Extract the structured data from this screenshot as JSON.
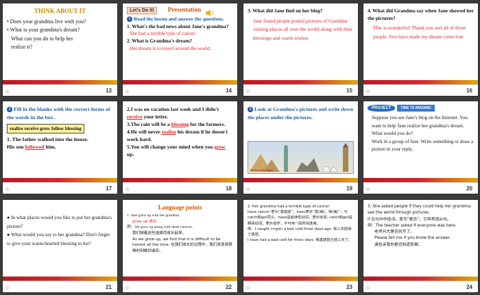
{
  "slides": [
    {
      "num": "13",
      "title": "THINK ABOUT IT",
      "lines": [
        "• Does your grandma live with you?",
        "• What is your grandma's dream?",
        "What can you do to help her",
        "realize it?"
      ]
    },
    {
      "num": "14",
      "title": "Presentation",
      "badge": "Let's Do It!",
      "heading": "Read the lesson and answer the questions.",
      "q1": "1. What's the bad news about Jane's grandma?",
      "a1": "She had a terrible type of cancer.",
      "q2": "2. What is Grandma's dream?",
      "a2": "Her dream is to travel around the world."
    },
    {
      "num": "15",
      "q": "3. What did Jane find on her blog?",
      "a": "Jane found people posted pictures of Grandma visiting places all over the world along with their blessings and warm wishes."
    },
    {
      "num": "16",
      "q": "4. What did Grandma say when Jane showed her the pictures?",
      "a": "This is wonderful! Thank you and all of those people. You have made my dream come true."
    },
    {
      "num": "17",
      "heading": "Fill in the blanks with the correct forms of the words in the box .",
      "words": "realize receive grow follow blessing",
      "s1": "1. The father walked into the house.",
      "s2a": "His son",
      "s2ans": "followed",
      "s2b": "him."
    },
    {
      "num": "18",
      "l1a": "2.I was on vacation last week and I didn't",
      "l1ans": "receive",
      "l1b": "your letter.",
      "l2a": "3.The rain will be a",
      "l2ans": "blessing",
      "l2b": "for the farmers.",
      "l3a": "4.He will never",
      "l3ans": "realize",
      "l3b": "his dream if he doesn't work hard.",
      "l4a": "5.You will change your mind when you",
      "l4ans": "grow",
      "l4b": "up."
    },
    {
      "num": "19",
      "heading": "Look at Grandma's pictures and write down the places under the pictures.",
      "captions": [
        "The Pyramids, Egypt",
        "The Statue of Liberty, the USA",
        "The Great Wall, China",
        "the Sydney Opera House, Australia",
        "Big Ben, England"
      ]
    },
    {
      "num": "20",
      "project": "PROJECT",
      "imagine": "TIME TO IMAGINE!",
      "p1": "Suppose you see Jane's blog on the Internet. You want to help Jane realize her grandma's dream. What would you do?",
      "p2": "Work in a group of four. Write something or draw a picture in your reply."
    },
    {
      "num": "21",
      "l1": "● In what places would you like to put her grandma's picture?",
      "l2": "● What would you say to her grandma? Don't forget to give your warm-hearted blessing to her!"
    },
    {
      "num": "22",
      "title": "Language points",
      "l1": "1. Jane grew up with her grandma.",
      "l1b": "grow up 成长",
      "l2": "例：We grow up along with these choices.",
      "l2cn": "我们随着这些选择而成长起来。",
      "l3": "As we grow up, we find that it is difficult to be honest all the time. 在我们成长的过程中，我们发现将很难时刻做到诚实。"
    },
    {
      "num": "23",
      "l1": "2. Her grandma had a terrible type of cancer.",
      "l2": "have cancer 意为“患癌症”。have表示“患(病)，得(病)”，与catch和get同义。have是延续性动词，表示状态; catch和get是瞬间动词，表示动作，不可用一段时间连用。",
      "l3": "例：I caught (=got) a bad cold three days ago. 我三天前得了感冒。",
      "l4": "I have had a bad cold for three days. 我患感冒已经三天了。"
    },
    {
      "num": "24",
      "l1": "3. She asked people if they could help her grandma see the world through pictures.",
      "l2": "if 在句中作连词，意为“是否”，引导宾语从句。",
      "l3": "例：The teacher asked if everyone was here.",
      "l4": "老师问大是否到齐了。",
      "l5": "Please tell me if you know the answer.",
      "l6": "请告诉我你是否知道答案。"
    }
  ]
}
